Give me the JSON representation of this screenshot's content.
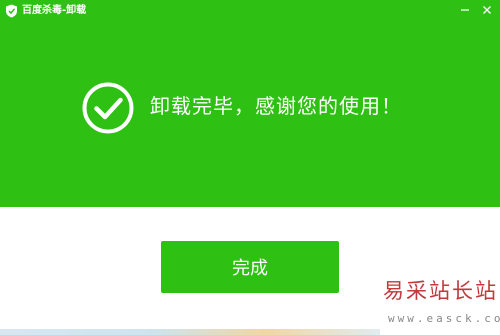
{
  "window": {
    "title": "百度杀毒-卸载",
    "minimize_icon": "minimize-icon",
    "close_icon": "close-icon"
  },
  "status": {
    "icon": "check-circle-icon",
    "message": "卸载完毕，感谢您的使用！"
  },
  "actions": {
    "done_label": "完成"
  },
  "watermark": {
    "text": "易采站长站",
    "url": "www.easck.com"
  },
  "colors": {
    "brand_green": "#2ec012",
    "watermark_red": "#c0393b"
  }
}
